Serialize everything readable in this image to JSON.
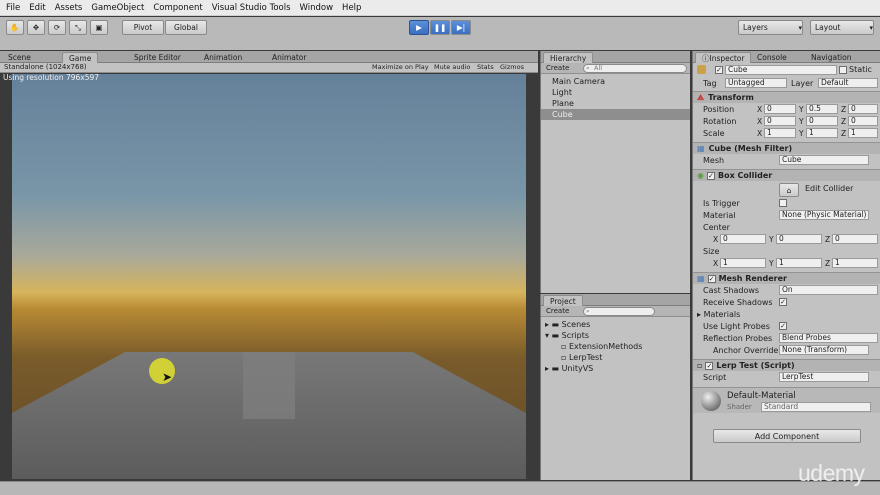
{
  "menu": [
    "File",
    "Edit",
    "Assets",
    "GameObject",
    "Component",
    "Visual Studio Tools",
    "Window",
    "Help"
  ],
  "toolbar": {
    "pivot": "Pivot",
    "global": "Global",
    "layers": "Layers",
    "layout": "Layout"
  },
  "tabs_left": [
    "Scene",
    "Game",
    "Sprite Editor",
    "Animation",
    "Animator"
  ],
  "game": {
    "resolution": "Standalone (1024x768)",
    "using_res": "Using resolution 796x597",
    "options": [
      "Maximize on Play",
      "Mute audio",
      "Stats",
      "Gizmos"
    ]
  },
  "hierarchy": {
    "title": "Hierarchy",
    "create": "Create",
    "search": "All",
    "items": [
      "Main Camera",
      "Light",
      "Plane",
      "Cube"
    ]
  },
  "project": {
    "title": "Project",
    "create": "Create",
    "items": [
      "Scenes",
      "Scripts",
      "ExtensionMethods",
      "LerpTest",
      "UnityVS"
    ]
  },
  "inspector": {
    "tabs": [
      "Inspector",
      "Console",
      "Navigation"
    ],
    "object_name": "Cube",
    "static": "Static",
    "tag_label": "Tag",
    "tag": "Untagged",
    "layer_label": "Layer",
    "layer": "Default",
    "transform": {
      "title": "Transform",
      "rows": [
        {
          "label": "Position",
          "x": "0",
          "y": "0.5",
          "z": "0"
        },
        {
          "label": "Rotation",
          "x": "0",
          "y": "0",
          "z": "0"
        },
        {
          "label": "Scale",
          "x": "1",
          "y": "1",
          "z": "1"
        }
      ]
    },
    "mesh_filter": {
      "title": "Cube (Mesh Filter)",
      "mesh_label": "Mesh",
      "mesh": "Cube"
    },
    "box_collider": {
      "title": "Box Collider",
      "edit": "Edit Collider",
      "is_trigger": "Is Trigger",
      "material_label": "Material",
      "material": "None (Physic Material)",
      "center_label": "Center",
      "center": {
        "x": "0",
        "y": "0",
        "z": "0"
      },
      "size_label": "Size",
      "size": {
        "x": "1",
        "y": "1",
        "z": "1"
      }
    },
    "mesh_renderer": {
      "title": "Mesh Renderer",
      "cast_label": "Cast Shadows",
      "cast": "On",
      "receive_label": "Receive Shadows",
      "materials_label": "Materials",
      "light_probes_label": "Use Light Probes",
      "reflection_label": "Reflection Probes",
      "reflection": "Blend Probes",
      "anchor_label": "Anchor Override",
      "anchor": "None (Transform)"
    },
    "script": {
      "title": "Lerp Test (Script)",
      "label": "Script",
      "value": "LerpTest"
    },
    "material": {
      "name": "Default-Material",
      "shader_label": "Shader",
      "shader": "Standard"
    },
    "add_component": "Add Component"
  },
  "watermark": "udemy"
}
